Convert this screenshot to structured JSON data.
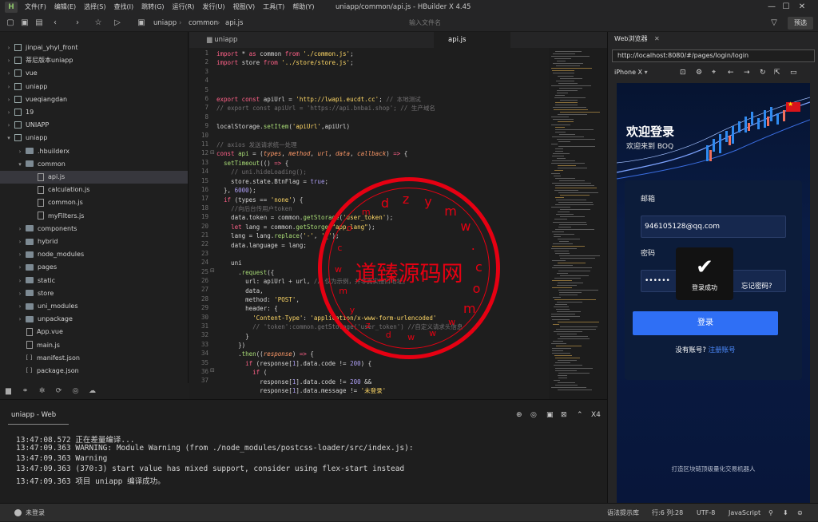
{
  "app": {
    "title": "uniapp/common/api.js - HBuilder X 4.45",
    "logo": "H",
    "menu": [
      "文件(F)",
      "编辑(E)",
      "选择(S)",
      "查找(I)",
      "跳转(G)",
      "运行(R)",
      "发行(U)",
      "视图(V)",
      "工具(T)",
      "帮助(Y)"
    ],
    "window_controls": {
      "minimize": "—",
      "maximize": "☐",
      "close": "✕"
    }
  },
  "toolbar": {
    "breadcrumb": [
      "uniapp",
      "common",
      "api.js"
    ],
    "search_placeholder": "输入文件名",
    "preview_label": "预选",
    "filter_icon": "filter-icon"
  },
  "sidebar": {
    "items": [
      {
        "label": "jinpai_yhyl_front",
        "level": 0,
        "type": "project",
        "expanded": false
      },
      {
        "label": "蒂尼版本uniapp",
        "level": 0,
        "type": "project",
        "expanded": false
      },
      {
        "label": "vue",
        "level": 0,
        "type": "project",
        "expanded": false
      },
      {
        "label": "uniapp",
        "level": 0,
        "type": "project",
        "expanded": false
      },
      {
        "label": "vueqiangdan",
        "level": 0,
        "type": "project",
        "expanded": false
      },
      {
        "label": "19",
        "level": 0,
        "type": "project",
        "expanded": false
      },
      {
        "label": "UNIAPP",
        "level": 0,
        "type": "project",
        "expanded": false
      },
      {
        "label": "uniapp",
        "level": 0,
        "type": "project",
        "expanded": true
      },
      {
        "label": ".hbuilderx",
        "level": 1,
        "type": "folder",
        "expanded": false
      },
      {
        "label": "common",
        "level": 1,
        "type": "folder",
        "expanded": true
      },
      {
        "label": "api.js",
        "level": 2,
        "type": "file",
        "selected": true
      },
      {
        "label": "calculation.js",
        "level": 2,
        "type": "file"
      },
      {
        "label": "common.js",
        "level": 2,
        "type": "file"
      },
      {
        "label": "myFilters.js",
        "level": 2,
        "type": "file"
      },
      {
        "label": "components",
        "level": 1,
        "type": "folder",
        "expanded": false
      },
      {
        "label": "hybrid",
        "level": 1,
        "type": "folder",
        "expanded": false
      },
      {
        "label": "node_modules",
        "level": 1,
        "type": "folder",
        "expanded": false
      },
      {
        "label": "pages",
        "level": 1,
        "type": "folder",
        "expanded": false
      },
      {
        "label": "static",
        "level": 1,
        "type": "folder",
        "expanded": false
      },
      {
        "label": "store",
        "level": 1,
        "type": "folder",
        "expanded": false
      },
      {
        "label": "uni_modules",
        "level": 1,
        "type": "folder",
        "expanded": false
      },
      {
        "label": "unpackage",
        "level": 1,
        "type": "folder",
        "expanded": false
      },
      {
        "label": "App.vue",
        "level": 1,
        "type": "file"
      },
      {
        "label": "main.js",
        "level": 1,
        "type": "file"
      },
      {
        "label": "manifest.json",
        "level": 1,
        "type": "json"
      },
      {
        "label": "package.json",
        "level": 1,
        "type": "json"
      }
    ]
  },
  "editor": {
    "tabs": [
      {
        "label": "uniapp",
        "active": false
      },
      {
        "label": "api.js",
        "active": true
      }
    ],
    "line_numbers": [
      "1",
      "2",
      "3",
      "4",
      "5",
      "6",
      "7",
      "8",
      "9",
      "10",
      "11",
      "12",
      "13",
      "14",
      "15",
      "16",
      "17",
      "18",
      "19",
      "20",
      "21",
      "22",
      "23",
      "24",
      "25",
      "26",
      "27",
      "28",
      "29",
      "30",
      "31",
      "32",
      "33",
      "34",
      "35",
      "36",
      "37"
    ]
  },
  "watermark": {
    "text": "道臻源码网",
    "ring_chars": [
      "d",
      "z",
      "y",
      "m",
      "w",
      ".",
      "c",
      "o",
      "m",
      "w",
      "w",
      "w",
      "d",
      "z",
      "y",
      "m",
      "w",
      "c",
      "o",
      "m"
    ]
  },
  "console": {
    "tab_label": "uniapp - Web",
    "close_label": "X4",
    "lines": [
      "13:47:08.572 正在差量编译...",
      "13:47:09.363 WARNING: Module Warning (from ./node_modules/postcss-loader/src/index.js):",
      "13:47:09.363 Warning",
      "13:47:09.363 (370:3) start value has mixed support, consider using flex-start instead",
      "13:47:09.363 项目 uniapp 编译成功。"
    ]
  },
  "browser": {
    "tab_label": "Web浏览器",
    "url": "http://localhost:8080/#/pages/login/login",
    "device": "iPhone X",
    "page": {
      "hero_title": "欢迎登录",
      "hero_subtitle": "欢迎来到 BOQ",
      "email_label": "邮箱",
      "email_value": "946105128@qq.com",
      "password_label": "密码",
      "password_value": "••••••",
      "toast_text": "登录成功",
      "forgot_link": "忘记密码?",
      "login_button": "登录",
      "no_account": "没有账号? ",
      "register_link": "注册账号",
      "footer": "打造区块链顶级量化交易机器人"
    }
  },
  "statusbar": {
    "user": "未登录",
    "syntax_hint": "语法提示库",
    "position": "行:6  列:28",
    "encoding": "UTF-8",
    "language": "JavaScript"
  }
}
